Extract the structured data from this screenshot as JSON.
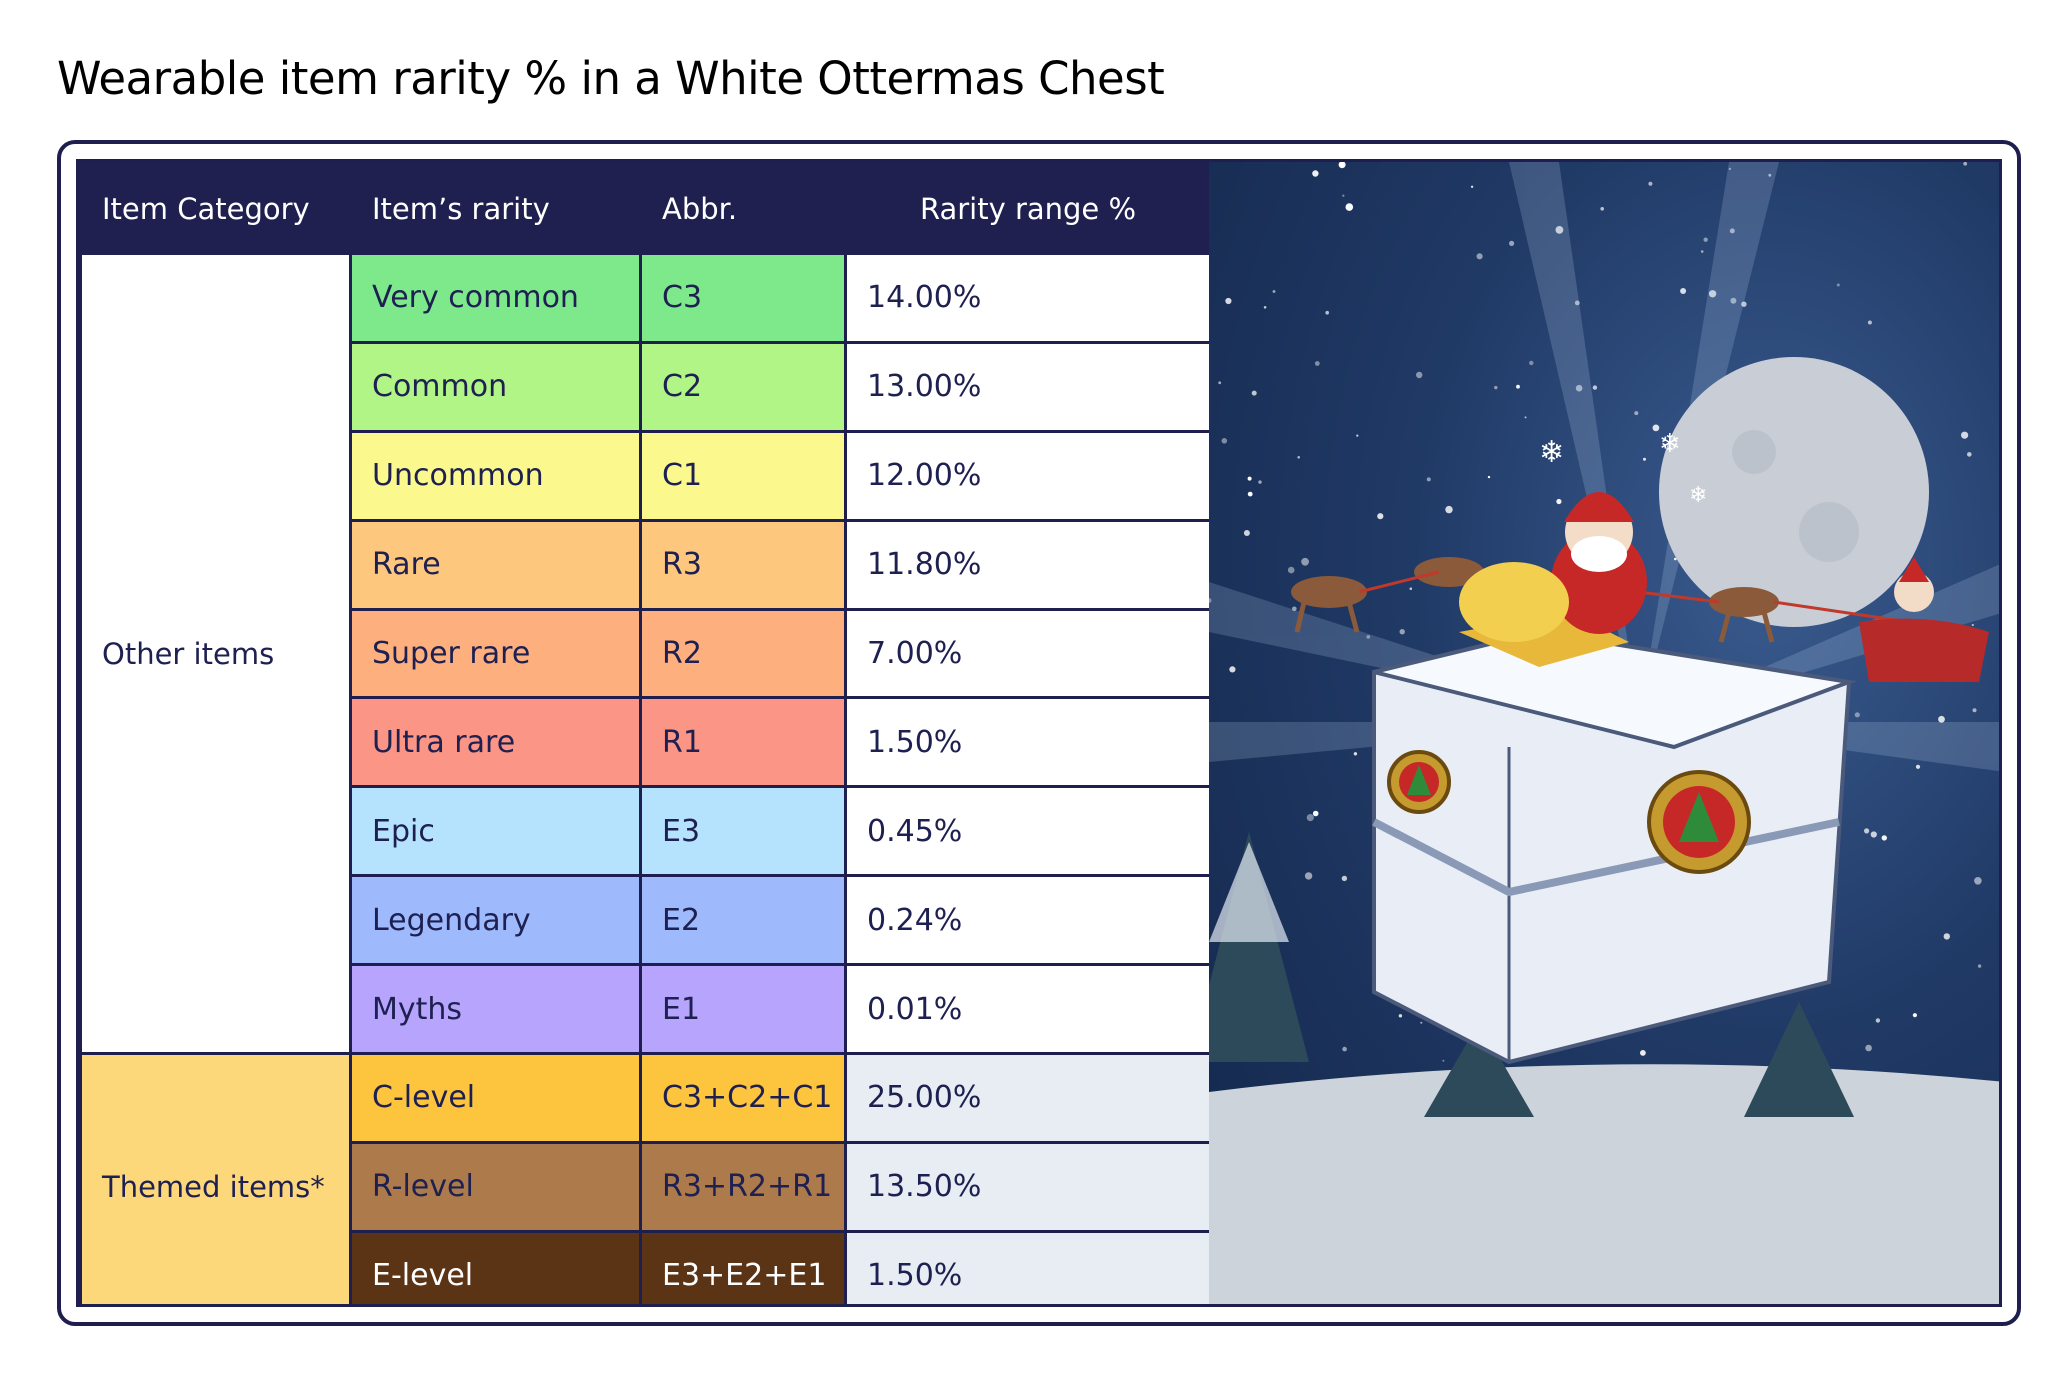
{
  "title": "Wearable item rarity % in a White Ottermas Chest",
  "headers": {
    "category": "Item Category",
    "rarity": "Item’s rarity",
    "abbr": "Abbr.",
    "range": "Rarity range %"
  },
  "groups": [
    {
      "category": "Other items",
      "rows": [
        {
          "rarity": "Very common",
          "abbr": "C3",
          "pct": "14.00%",
          "color": "#7de98a",
          "text": "#1d2050"
        },
        {
          "rarity": "Common",
          "abbr": "C2",
          "pct": "13.00%",
          "color": "#b0f585",
          "text": "#1d2050"
        },
        {
          "rarity": "Uncommon",
          "abbr": "C1",
          "pct": "12.00%",
          "color": "#fbf98d",
          "text": "#1d2050"
        },
        {
          "rarity": "Rare",
          "abbr": "R3",
          "pct": "11.80%",
          "color": "#fdc77e",
          "text": "#1d2050"
        },
        {
          "rarity": "Super rare",
          "abbr": "R2",
          "pct": "7.00%",
          "color": "#fdaf7d",
          "text": "#1d2050"
        },
        {
          "rarity": "Ultra rare",
          "abbr": "R1",
          "pct": "1.50%",
          "color": "#fb9585",
          "text": "#1d2050"
        },
        {
          "rarity": "Epic",
          "abbr": "E3",
          "pct": "0.45%",
          "color": "#b5e3fd",
          "text": "#1d2050"
        },
        {
          "rarity": "Legendary",
          "abbr": "E2",
          "pct": "0.24%",
          "color": "#9fb9fd",
          "text": "#1d2050"
        },
        {
          "rarity": "Myths",
          "abbr": "E1",
          "pct": "0.01%",
          "color": "#b6a4fd",
          "text": "#1d2050"
        }
      ]
    },
    {
      "category": "Themed items*",
      "rows": [
        {
          "rarity": "C-level",
          "abbr": "C3+C2+C1",
          "pct": "25.00%",
          "color": "#fdc43e",
          "text": "#1d2050"
        },
        {
          "rarity": "R-level",
          "abbr": "R3+R2+R1",
          "pct": "13.50%",
          "color": "#ad7a4c",
          "text": "#1d2050"
        },
        {
          "rarity": "E-level",
          "abbr": "E3+E2+E1",
          "pct": "1.50%",
          "color": "#5b3315",
          "text": "#ffffff"
        }
      ]
    }
  ],
  "colors": {
    "frame": "#1e1f4f",
    "header_bg": "#1f204f",
    "themed_category_bg": "#fdd87b",
    "themed_pct_bg": "#e7edf3"
  },
  "illustration": {
    "icons": [
      "moon-icon",
      "santa-icon",
      "reindeer-icon",
      "sleigh-icon",
      "chest-icon",
      "christmas-tree-icon",
      "snowflake-icon"
    ]
  }
}
